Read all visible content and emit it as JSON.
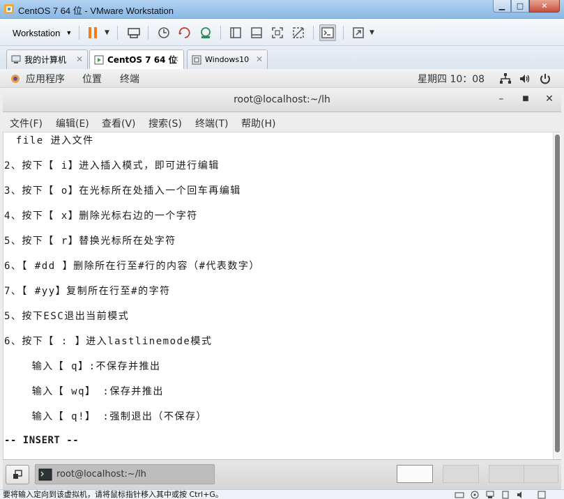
{
  "vmware": {
    "window_title": "CentOS 7 64 位 - VMware Workstation",
    "menu_label": "Workstation",
    "tabs": [
      {
        "label": "我的计算机",
        "icon": "computer-icon",
        "active": false
      },
      {
        "label": "CentOS 7 64 位",
        "icon": "vm-icon",
        "active": true
      },
      {
        "label": "Windows10",
        "icon": "vm-icon",
        "active": false
      }
    ],
    "status_text": "要将输入定向到该虚拟机，请将鼠标指针移入其中或按 Ctrl+G。"
  },
  "gnome": {
    "menus": [
      "应用程序",
      "位置",
      "终端"
    ],
    "clock": "星期四 10：08",
    "task_label": "root@localhost:~/lh"
  },
  "terminal": {
    "title": "root@localhost:~/lh",
    "menu": [
      "文件(F)",
      "编辑(E)",
      "查看(V)",
      "搜索(S)",
      "终端(T)",
      "帮助(H)"
    ],
    "lines": [
      " file 进入文件",
      "2、按下【 i】进入插入模式，即可进行编辑",
      "3、按下【 o】在光标所在处插入一个回车再编辑",
      "4、按下【 x】删除光标右边的一个字符",
      "5、按下【 r】替换光标所在处字符",
      "6、【 #dd 】删除所在行至#行的内容（#代表数字）",
      "7、【 #yy】复制所在行至#的字符",
      "5、按下ESC退出当前模式",
      "6、按下【 : 】进入lastlinemode模式",
      "    输入【 q】:不保存并推出",
      "    输入【 wq】 :保存并推出",
      "    输入【 q!】 :强制退出（不保存）"
    ],
    "mode_status": "-- INSERT --"
  },
  "colors": {
    "title_gradient": "#9cc3ea",
    "pause_orange": "#f07d1e",
    "terminal_bg": "#ffffff"
  }
}
